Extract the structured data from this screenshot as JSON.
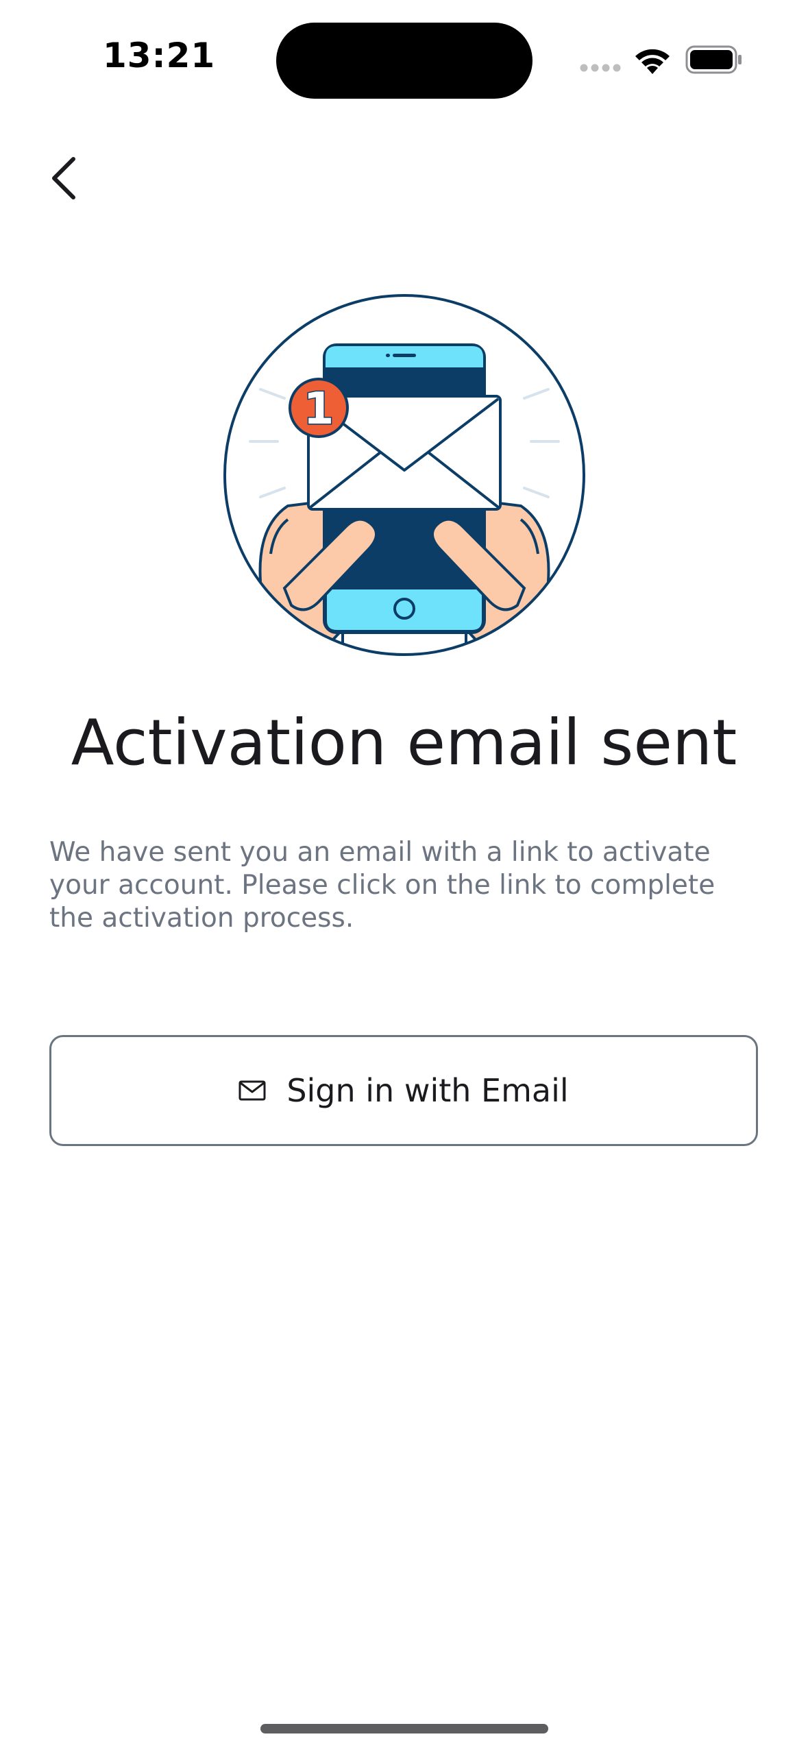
{
  "status_bar": {
    "time": "13:21"
  },
  "header": {
    "back_icon": "chevron-left-icon"
  },
  "illustration": {
    "badge_count": "1",
    "colors": {
      "navy": "#0b3d66",
      "cyan": "#6ee1fb",
      "skin": "#fcc9a9",
      "badge": "#ee5f36",
      "ray": "#d7e3ec"
    }
  },
  "main": {
    "title": "Activation email sent",
    "description": "We have sent you an email with a link to activate your account. Please click on the link to complete the activation process."
  },
  "actions": {
    "signin_label": "Sign in with Email",
    "signin_icon": "mail-icon"
  }
}
